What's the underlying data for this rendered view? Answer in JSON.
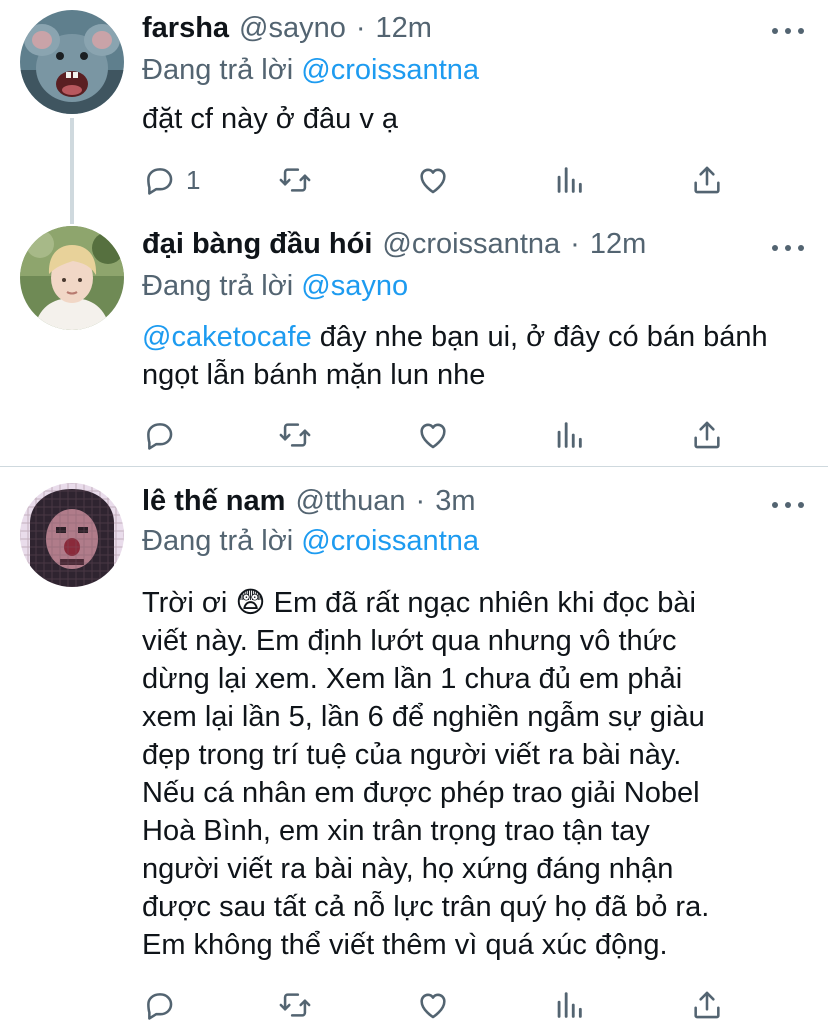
{
  "tweets": [
    {
      "name": "farsha",
      "handle": "@sayno",
      "time": "12m",
      "replying_prefix": "Đang trả lời",
      "replying_to": "@croissantna",
      "text": "đặt cf này ở đâu v ạ",
      "reply_count": "1",
      "avatar_icon": "rat-avatar"
    },
    {
      "name": "đại bàng đầu hói",
      "handle": "@croissantna",
      "time": "12m",
      "replying_prefix": "Đang trả lời",
      "replying_to": "@sayno",
      "mention": "@caketocafe",
      "text_after_mention": " đây nhe bạn ui, ở đây có bán bánh ngọt lẫn bánh mặn lun nhe",
      "reply_count": "",
      "avatar_icon": "person-avatar"
    },
    {
      "name": "lê thế nam",
      "handle": "@tthuan",
      "time": "3m",
      "replying_prefix": "Đang trả lời",
      "replying_to": "@croissantna",
      "text_lines": [
        "Trời ơi 😨  Em đã rất ngạc nhiên khi đọc bài",
        "viết này. Em định lướt qua nhưng vô thức",
        "dừng lại xem. Xem lần 1 chưa đủ em phải",
        "xem lại lần 5, lần 6 để nghiền ngẫm sự giàu",
        "đẹp trong trí tuệ của người viết ra bài này.",
        "Nếu cá nhân em được phép trao giải Nobel",
        "Hoà Bình, em xin trân trọng trao tận tay",
        "người viết ra bài này, họ xứng đáng nhận",
        "được sau tất cả nỗ lực trân quý họ đã bỏ ra.",
        "Em không thể viết thêm vì quá xúc động."
      ],
      "reply_count": "",
      "avatar_icon": "pixelated-avatar"
    }
  ],
  "separator": "·",
  "colors": {
    "accent": "#1d9bf0",
    "secondary_text": "#536471",
    "divider": "#cfd9de"
  }
}
